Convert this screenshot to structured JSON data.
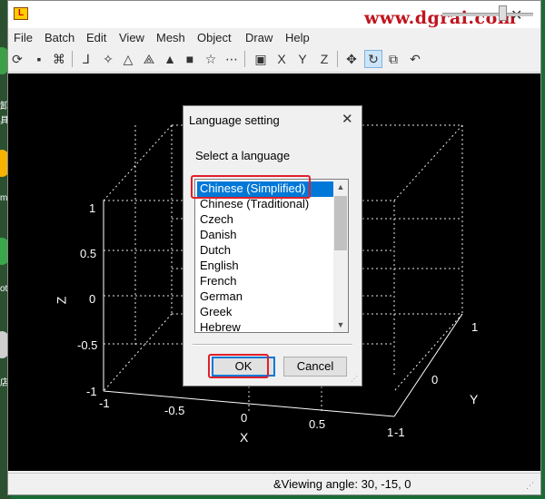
{
  "window": {
    "title_glyph": "L",
    "watermark": "www.dgrai.com"
  },
  "menu": [
    "File",
    "Batch",
    "Edit",
    "View",
    "Mesh",
    "Object",
    "Draw",
    "Help"
  ],
  "plot": {
    "z_label": "Z",
    "x_label": "X",
    "y_label": "Y",
    "z_ticks": [
      "1",
      "0.5",
      "0",
      "-0.5",
      "-1"
    ],
    "x_ticks": [
      "-1",
      "-0.5",
      "0",
      "0.5",
      "1"
    ],
    "y_ticks": [
      "-1",
      "0",
      "1"
    ]
  },
  "status": {
    "text": "&Viewing angle: 30, -15, 0"
  },
  "dialog": {
    "title": "Language setting",
    "close_glyph": "✕",
    "prompt": "Select a language",
    "languages": [
      "Chinese (Simplified)",
      "Chinese (Traditional)",
      "Czech",
      "Danish",
      "Dutch",
      "English",
      "French",
      "German",
      "Greek",
      "Hebrew"
    ],
    "selected_index": 0,
    "ok_label": "OK",
    "cancel_label": "Cancel"
  },
  "desktop": {
    "labels": [
      "卸",
      "具",
      "me",
      "ot",
      "店"
    ]
  },
  "colors": {
    "selection": "#0078d7",
    "highlight": "#e0202a",
    "watermark": "#c0141e"
  }
}
